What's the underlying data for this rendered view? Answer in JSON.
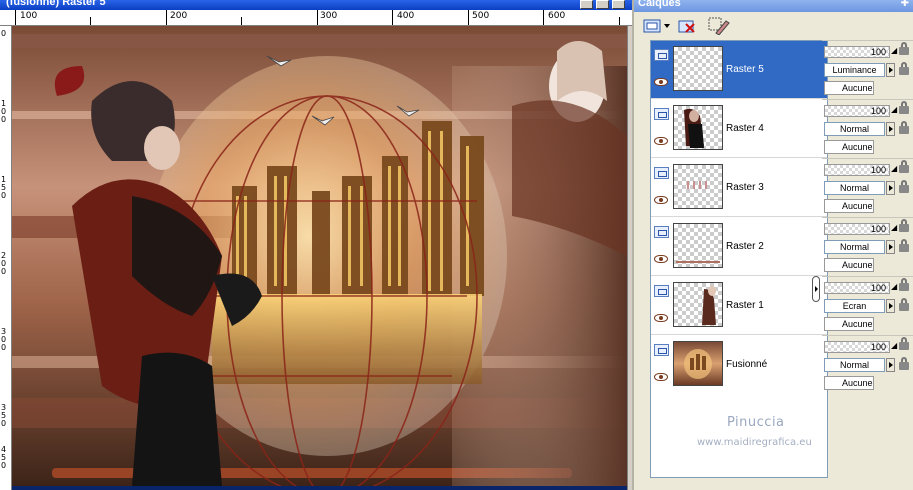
{
  "image_window": {
    "title": "(fusionné) Raster 5",
    "ruler_top_labels": [
      "100",
      "200",
      "300",
      "400",
      "500",
      "600"
    ],
    "ruler_left_labels": [
      "0",
      "1 0 0",
      "1 5 0",
      "2 0 0",
      "3 0 0",
      "3 5 0",
      "4 5 0"
    ],
    "canvas_description_icon": "artwork-image"
  },
  "palette": {
    "title": "Calques",
    "pin_icon": "pin-icon",
    "toolbar": {
      "new_layer_icon": "new-layer-icon",
      "delete_layer_icon": "delete-layer-icon",
      "edit_layer_icon": "edit-layer-icon"
    },
    "layers": [
      {
        "name": "Raster 5",
        "selected": true,
        "opacity": "100",
        "blend": "Luminance",
        "group": "Aucune"
      },
      {
        "name": "Raster 4",
        "selected": false,
        "opacity": "100",
        "blend": "Normal",
        "group": "Aucune"
      },
      {
        "name": "Raster 3",
        "selected": false,
        "opacity": "100",
        "blend": "Normal",
        "group": "Aucune"
      },
      {
        "name": "Raster 2",
        "selected": false,
        "opacity": "100",
        "blend": "Normal",
        "group": "Aucune"
      },
      {
        "name": "Raster 1",
        "selected": false,
        "opacity": "100",
        "blend": "Ecran",
        "group": "Aucune"
      },
      {
        "name": "Fusionné",
        "selected": false,
        "opacity": "100",
        "blend": "Normal",
        "group": "Aucune"
      }
    ]
  },
  "watermark": {
    "name": "Pinuccia",
    "url": "www.maidiregrafica.eu"
  },
  "colors": {
    "selection": "#316ac5",
    "palette_bg": "#ece9d8",
    "title_bar": "#2a64e8"
  }
}
